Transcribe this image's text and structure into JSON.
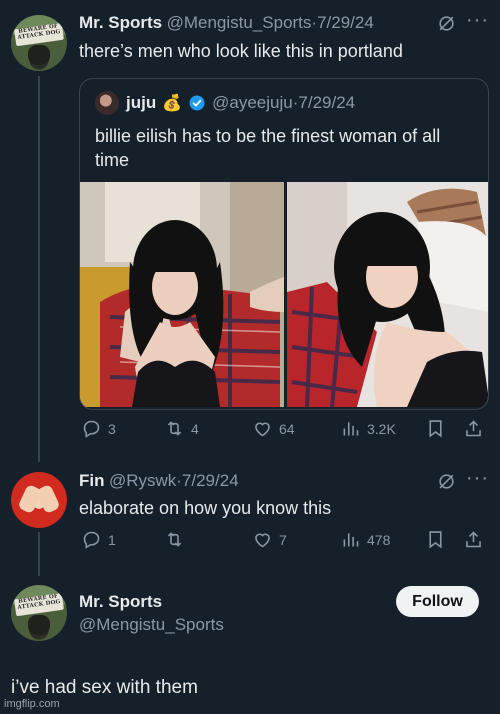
{
  "tweet1": {
    "name": "Mr. Sports",
    "handle": "@Mengistu_Sports",
    "date": "·7/29/24",
    "text": "there’s men who look like this in portland",
    "avatar_sign_lines": [
      "BEWARE OF",
      "ATTACK DOG"
    ]
  },
  "quote": {
    "name": "juju",
    "handle": "@ayeejuju",
    "date": "·7/29/24",
    "text_line1": "billie eilish has to be the finest woman of all",
    "text_line2": "time"
  },
  "tweet1_actions": {
    "replies": "3",
    "reposts": "4",
    "likes": "64",
    "views": "3.2K"
  },
  "tweet2": {
    "name": "Fin",
    "handle": "@Ryswk",
    "date": "·7/29/24",
    "text": "elaborate on how you know this"
  },
  "tweet2_actions": {
    "replies": "1",
    "reposts": "",
    "likes": "7",
    "views": "478"
  },
  "tweet3": {
    "name": "Mr. Sports",
    "handle": "@Mengistu_Sports",
    "follow_label": "Follow",
    "text": "i’ve had sex with them"
  },
  "watermark": "imgflip.com",
  "colors": {
    "background": "#15202b",
    "text": "#e7e9ea",
    "muted": "#8b98a5",
    "verified": "#1d9bf0",
    "border": "#38444d"
  }
}
